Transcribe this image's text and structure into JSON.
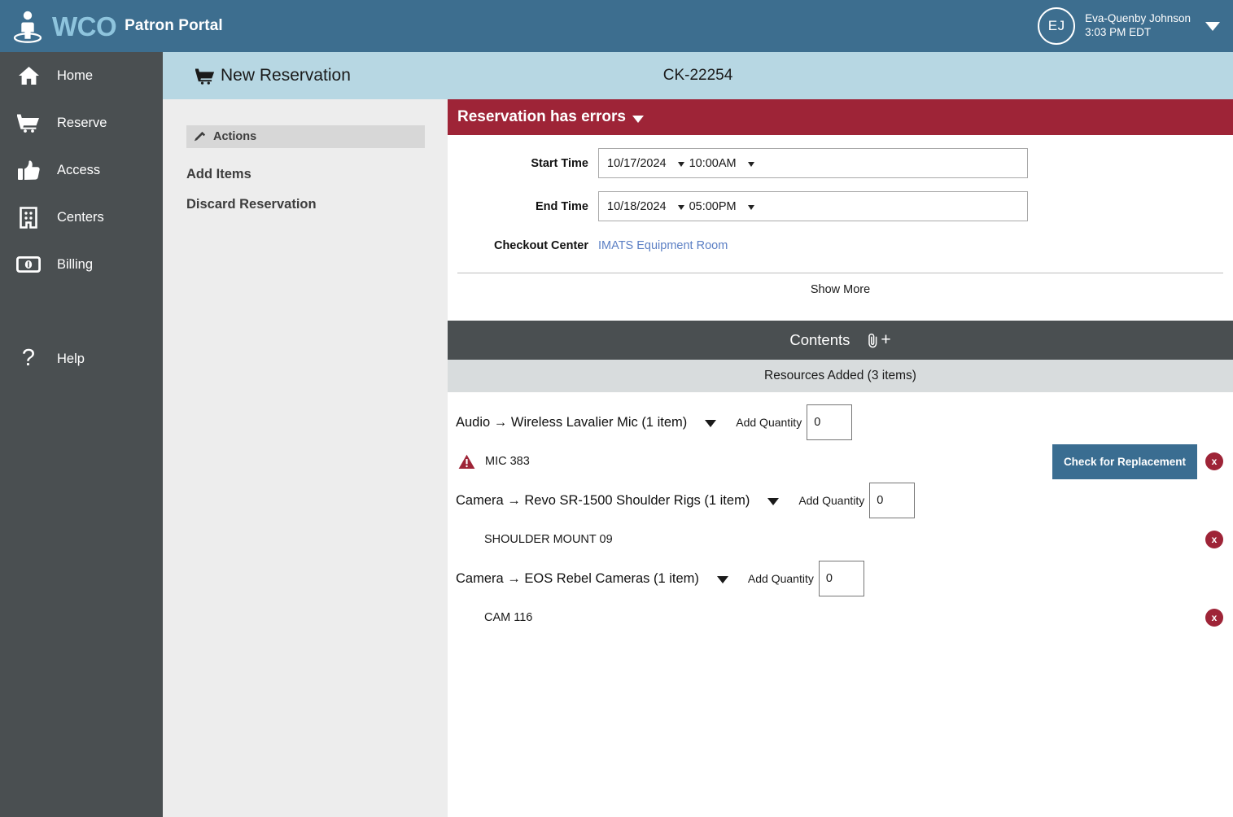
{
  "topbar": {
    "brand_wco": "WCO",
    "brand_portal": "Patron Portal",
    "user": {
      "initials": "EJ",
      "name": "Eva-Quenby Johnson",
      "time": "3:03 PM EDT"
    }
  },
  "sidebar": {
    "items": [
      {
        "label": "Home",
        "icon": "home-icon"
      },
      {
        "label": "Reserve",
        "icon": "cart-icon"
      },
      {
        "label": "Access",
        "icon": "thumbs-up-icon"
      },
      {
        "label": "Centers",
        "icon": "building-icon"
      },
      {
        "label": "Billing",
        "icon": "money-icon"
      }
    ],
    "help": {
      "label": "Help",
      "icon": "question-icon"
    }
  },
  "page_header": {
    "title": "New Reservation",
    "reservation_id": "CK-22254"
  },
  "actions_panel": {
    "heading": "Actions",
    "add_items": "Add Items",
    "discard_reservation": "Discard Reservation"
  },
  "main": {
    "error_banner": "Reservation has errors",
    "fields": {
      "start_time_label": "Start Time",
      "start_date": "10/17/2024",
      "start_time": "10:00AM",
      "end_time_label": "End Time",
      "end_date": "10/18/2024",
      "end_time": "05:00PM",
      "checkout_center_label": "Checkout Center",
      "checkout_center_value": "IMATS Equipment Room"
    },
    "show_more": "Show More",
    "contents_title": "Contents",
    "attach_icon": "paperclip-add-icon",
    "resources_added": "Resources Added (3 items)",
    "add_quantity_label": "Add Quantity",
    "check_replacement_label": "Check for Replacement",
    "delete_label": "x",
    "resources": [
      {
        "name": "Audio → Wireless Lavalier Mic (1 item)",
        "quantity": "0",
        "tag": "MIC 383",
        "has_warning": true,
        "has_replacement_button": true
      },
      {
        "name": "Camera → Revo SR-1500 Shoulder Rigs (1 item)",
        "quantity": "0",
        "tag": "SHOULDER MOUNT 09",
        "has_warning": false,
        "has_replacement_button": false
      },
      {
        "name": "Camera → EOS Rebel Cameras (1 item)",
        "quantity": "0",
        "tag": "CAM 116",
        "has_warning": false,
        "has_replacement_button": false
      }
    ]
  },
  "colors": {
    "topbar": "#3d6e8f",
    "sidebar": "#4a4f51",
    "page_header": "#b7d7e3",
    "error": "#9e2437",
    "accent_button": "#3a6d91",
    "link": "#5b7fc4"
  }
}
